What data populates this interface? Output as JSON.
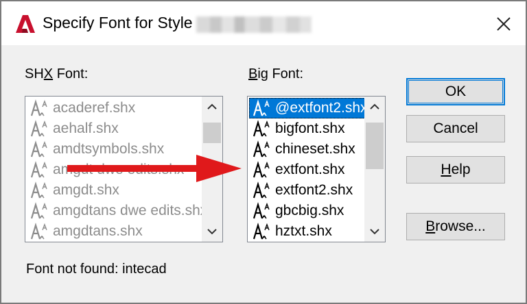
{
  "window": {
    "title": "Specify Font for Style",
    "close_glyph": "✕"
  },
  "shx": {
    "label_pre": "SH",
    "label_u": "X",
    "label_post": " Font:",
    "items": [
      "acaderef.shx",
      "aehalf.shx",
      "amdtsymbols.shx",
      "amgdt dwe edits.shx",
      "amgdt.shx",
      "amgdtans dwe edits.shx",
      "amgdtans.shx"
    ]
  },
  "bigfont": {
    "label_u": "B",
    "label_post": "ig Font:",
    "items": [
      "@extfont2.shx",
      "bigfont.shx",
      "chineset.shx",
      "extfont.shx",
      "extfont2.shx",
      "gbcbig.shx",
      "hztxt.shx"
    ],
    "selected_index": 0
  },
  "buttons": {
    "ok": "OK",
    "cancel": "Cancel",
    "help_u": "H",
    "help_rest": "elp",
    "browse_u": "B",
    "browse_rest": "rowse..."
  },
  "status": "Font not found: intecad",
  "icons": {
    "app": "autocad-logo-icon",
    "font_item": "shx-font-icon",
    "annotation": "red-arrow"
  },
  "colors": {
    "selection": "#0078d7",
    "arrow": "#e0191b",
    "logo": "#c8102e"
  }
}
